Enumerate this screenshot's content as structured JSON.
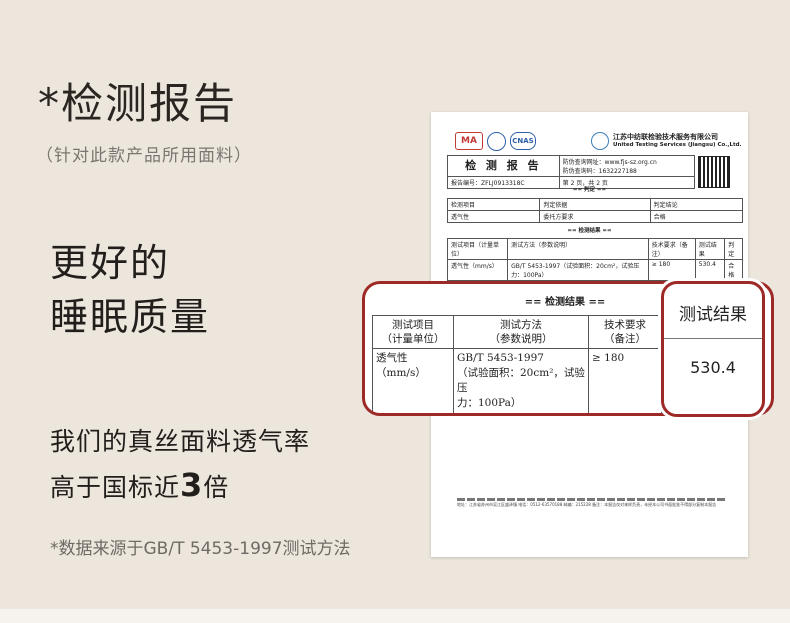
{
  "title": "*检测报告",
  "subtitle": "（针对此款产品所用面料）",
  "headline": [
    "更好的",
    "睡眠质量"
  ],
  "description": {
    "line1": "我们的真丝面料透气率",
    "line2_prefix": "高于国标近",
    "line2_number": "3",
    "line2_suffix": "倍"
  },
  "source_note": "*数据来源于GB/T 5453-1997测试方法",
  "report": {
    "logo_ma": "MA",
    "logo_cnas": "CNAS",
    "org_name_cn": "江苏中纺联检验技术服务有限公司",
    "org_name_en": "United Testing Services (Jiangsu) Co.,Ltd.",
    "report_title": "检 测 报 告",
    "query_site": "防伪查询网址：www.fjs-sz.org.cn",
    "query_code": "防伪查询码：1632227188",
    "report_no_label": "报告编号：ZFLJ0913318C",
    "page_info": "第 2 页，共 2 页",
    "judge_section": "== 判定 ==",
    "judge_headers": [
      "检测项目",
      "判定依据",
      "判定结论"
    ],
    "judge_row": [
      "透气性",
      "委托方要求",
      "合格"
    ],
    "results_section": "== 检测结果 ==",
    "result_headers": [
      "测试项目（计量单位）",
      "测试方法（参数说明）",
      "技术要求（备注）",
      "测试结果",
      "判定"
    ],
    "result_row": [
      "透气性（mm/s）",
      "GB/T 5453-1997（试验面积：20cm²，试验压力：100Pa）",
      "≥ 180",
      "530.4",
      "合格"
    ],
    "footer": "地址：江苏省苏州市吴江区盛泽镇 电话：0512-63570188 邮编：215228 备注：本报告仅对来样负责，未经本公司书面批准不得部分复制本报告"
  },
  "callout": {
    "section_label": "== 检测结果 ==",
    "headers": {
      "item": [
        "测试项目",
        "（计量单位）"
      ],
      "method": [
        "测试方法",
        "（参数说明）"
      ],
      "requirement": [
        "技术要求",
        "（备注）"
      ]
    },
    "row": {
      "item": "透气性（mm/s）",
      "method_line1": "GB/T 5453-1997",
      "method_line2": "（试验面积：20cm²，试验压",
      "method_line3": "力：100Pa）",
      "requirement": "≥ 180"
    },
    "result_label": "测试结果",
    "result_value": "530.4"
  },
  "colors": {
    "background": "#ece6dc",
    "highlight_border": "#9e2a28",
    "title_text": "#2b2522"
  }
}
